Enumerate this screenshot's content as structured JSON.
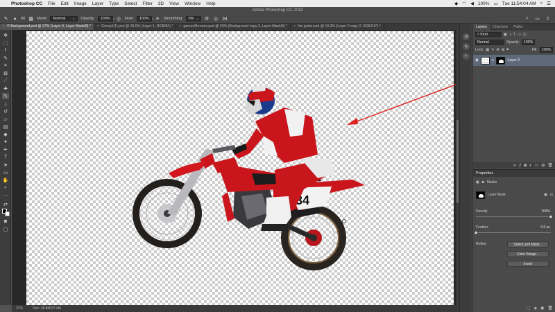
{
  "menubar": {
    "app": "Photoshop CC",
    "items": [
      "File",
      "Edit",
      "Image",
      "Layer",
      "Type",
      "Select",
      "Filter",
      "3D",
      "View",
      "Window",
      "Help"
    ],
    "battery": "100%",
    "clock": "Tue 11:54:04 AM"
  },
  "window_title": "Adobe Photoshop CC 2019",
  "options": {
    "brush_size": "40",
    "mode_label": "Mode:",
    "mode_value": "Normal",
    "opacity_label": "Opacity:",
    "opacity_value": "100%",
    "flow_label": "Flow:",
    "flow_value": "100%",
    "smoothing_label": "Smoothing:",
    "smoothing_value": "0%"
  },
  "tabs": [
    {
      "label": "© Background.psd @ 37% (Layer 0, Layer Mask/8) *"
    },
    {
      "label": "Group1(1).psd @ 29.6% (Layer 1, RGB/8#) *"
    },
    {
      "label": "gameofthrones.psd @ 20% (Background copy 2, Layer Mask/8) *"
    },
    {
      "label": "fire guitar.psd @ 16.3% (Layer 0 copy 2, RGB/16*) *"
    }
  ],
  "status": {
    "zoom": "37%",
    "doc": "Doc: 28.8M/37.4M"
  },
  "layers_panel": {
    "tabs": [
      "Layers",
      "Channels",
      "Paths"
    ],
    "kind_value": "Kind",
    "blend_value": "Normal",
    "opacity_label": "Opacity:",
    "opacity_value": "100%",
    "lock_label": "Lock:",
    "fill_label": "Fill:",
    "fill_value": "100%",
    "layer_name": "Layer 0"
  },
  "properties": {
    "title": "Properties",
    "section": "Masks",
    "mask_label": "Layer Mask",
    "density_label": "Density:",
    "density_value": "100%",
    "feather_label": "Feather:",
    "feather_value": "0.0 px",
    "refine_label": "Refine:",
    "btn_select_mask": "Select and Mask...",
    "btn_color_range": "Color Range...",
    "btn_invert": "Invert"
  },
  "colors": {
    "annotation_arrow": "#e0201c",
    "layer_selected": "#5e6a7a"
  }
}
